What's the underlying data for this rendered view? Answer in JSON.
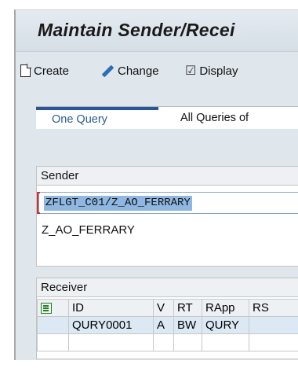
{
  "window": {
    "title": "Maintain Sender/Recei"
  },
  "toolbar": {
    "buttons": [
      {
        "label": "Create",
        "icon": "document-icon"
      },
      {
        "label": "Change",
        "icon": "pencil-icon"
      },
      {
        "label": "Display",
        "icon": "glasses-icon"
      }
    ]
  },
  "tabs": [
    {
      "label": "One Query",
      "active": true
    },
    {
      "label": "All Queries of",
      "active": false
    }
  ],
  "sender": {
    "heading": "Sender",
    "value": "ZFLGT_C01/Z_AO_FERRARY",
    "description": "Z_AO_FERRARY"
  },
  "receiver": {
    "heading": "Receiver",
    "columns": [
      "ID",
      "V",
      "RT",
      "RApp",
      "RS"
    ],
    "rows": [
      {
        "ID": "QURY0001",
        "V": "A",
        "RT": "BW",
        "RApp": "QURY",
        "RS": ""
      }
    ]
  },
  "colors": {
    "accent": "#27579a",
    "selection": "#8fb7e2",
    "required": "#d0302b"
  }
}
